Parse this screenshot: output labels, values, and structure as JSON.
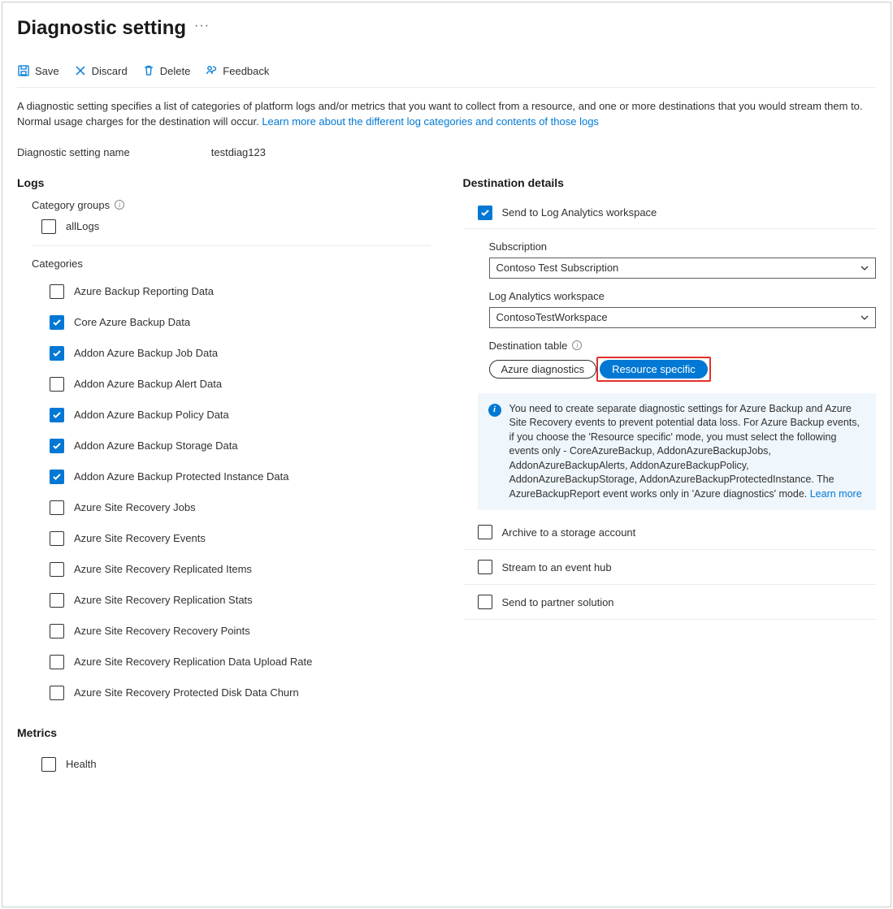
{
  "header": {
    "title": "Diagnostic setting"
  },
  "toolbar": {
    "save": "Save",
    "discard": "Discard",
    "delete": "Delete",
    "feedback": "Feedback"
  },
  "description": {
    "text": "A diagnostic setting specifies a list of categories of platform logs and/or metrics that you want to collect from a resource, and one or more destinations that you would stream them to. Normal usage charges for the destination will occur. ",
    "link": "Learn more about the different log categories and contents of those logs"
  },
  "setting_name": {
    "label": "Diagnostic setting name",
    "value": "testdiag123"
  },
  "logs": {
    "title": "Logs",
    "category_groups_label": "Category groups",
    "groups": [
      {
        "label": "allLogs",
        "checked": false
      }
    ],
    "categories_label": "Categories",
    "categories": [
      {
        "label": "Azure Backup Reporting Data",
        "checked": false
      },
      {
        "label": "Core Azure Backup Data",
        "checked": true
      },
      {
        "label": "Addon Azure Backup Job Data",
        "checked": true
      },
      {
        "label": "Addon Azure Backup Alert Data",
        "checked": false
      },
      {
        "label": "Addon Azure Backup Policy Data",
        "checked": true
      },
      {
        "label": "Addon Azure Backup Storage Data",
        "checked": true
      },
      {
        "label": "Addon Azure Backup Protected Instance Data",
        "checked": true
      },
      {
        "label": "Azure Site Recovery Jobs",
        "checked": false
      },
      {
        "label": "Azure Site Recovery Events",
        "checked": false
      },
      {
        "label": "Azure Site Recovery Replicated Items",
        "checked": false
      },
      {
        "label": "Azure Site Recovery Replication Stats",
        "checked": false
      },
      {
        "label": "Azure Site Recovery Recovery Points",
        "checked": false
      },
      {
        "label": "Azure Site Recovery Replication Data Upload Rate",
        "checked": false
      },
      {
        "label": "Azure Site Recovery Protected Disk Data Churn",
        "checked": false
      }
    ]
  },
  "metrics": {
    "title": "Metrics",
    "items": [
      {
        "label": "Health",
        "checked": false
      }
    ]
  },
  "destination": {
    "title": "Destination details",
    "send_la": {
      "label": "Send to Log Analytics workspace",
      "checked": true
    },
    "subscription": {
      "label": "Subscription",
      "value": "Contoso Test Subscription"
    },
    "workspace": {
      "label": "Log Analytics workspace",
      "value": "ContosoTestWorkspace"
    },
    "dest_table": {
      "label": "Destination table",
      "options": [
        "Azure diagnostics",
        "Resource specific"
      ],
      "selected": "Resource specific"
    },
    "callout": {
      "text": "You need to create separate diagnostic settings for Azure Backup and Azure Site Recovery events to prevent potential data loss. For Azure Backup events, if you choose the 'Resource specific' mode, you must select the following events only - CoreAzureBackup, AddonAzureBackupJobs, AddonAzureBackupAlerts, AddonAzureBackupPolicy, AddonAzureBackupStorage, AddonAzureBackupProtectedInstance. The AzureBackupReport event works only in 'Azure diagnostics' mode.  ",
      "link": "Learn more"
    },
    "archive": {
      "label": "Archive to a storage account",
      "checked": false
    },
    "eventhub": {
      "label": "Stream to an event hub",
      "checked": false
    },
    "partner": {
      "label": "Send to partner solution",
      "checked": false
    }
  }
}
